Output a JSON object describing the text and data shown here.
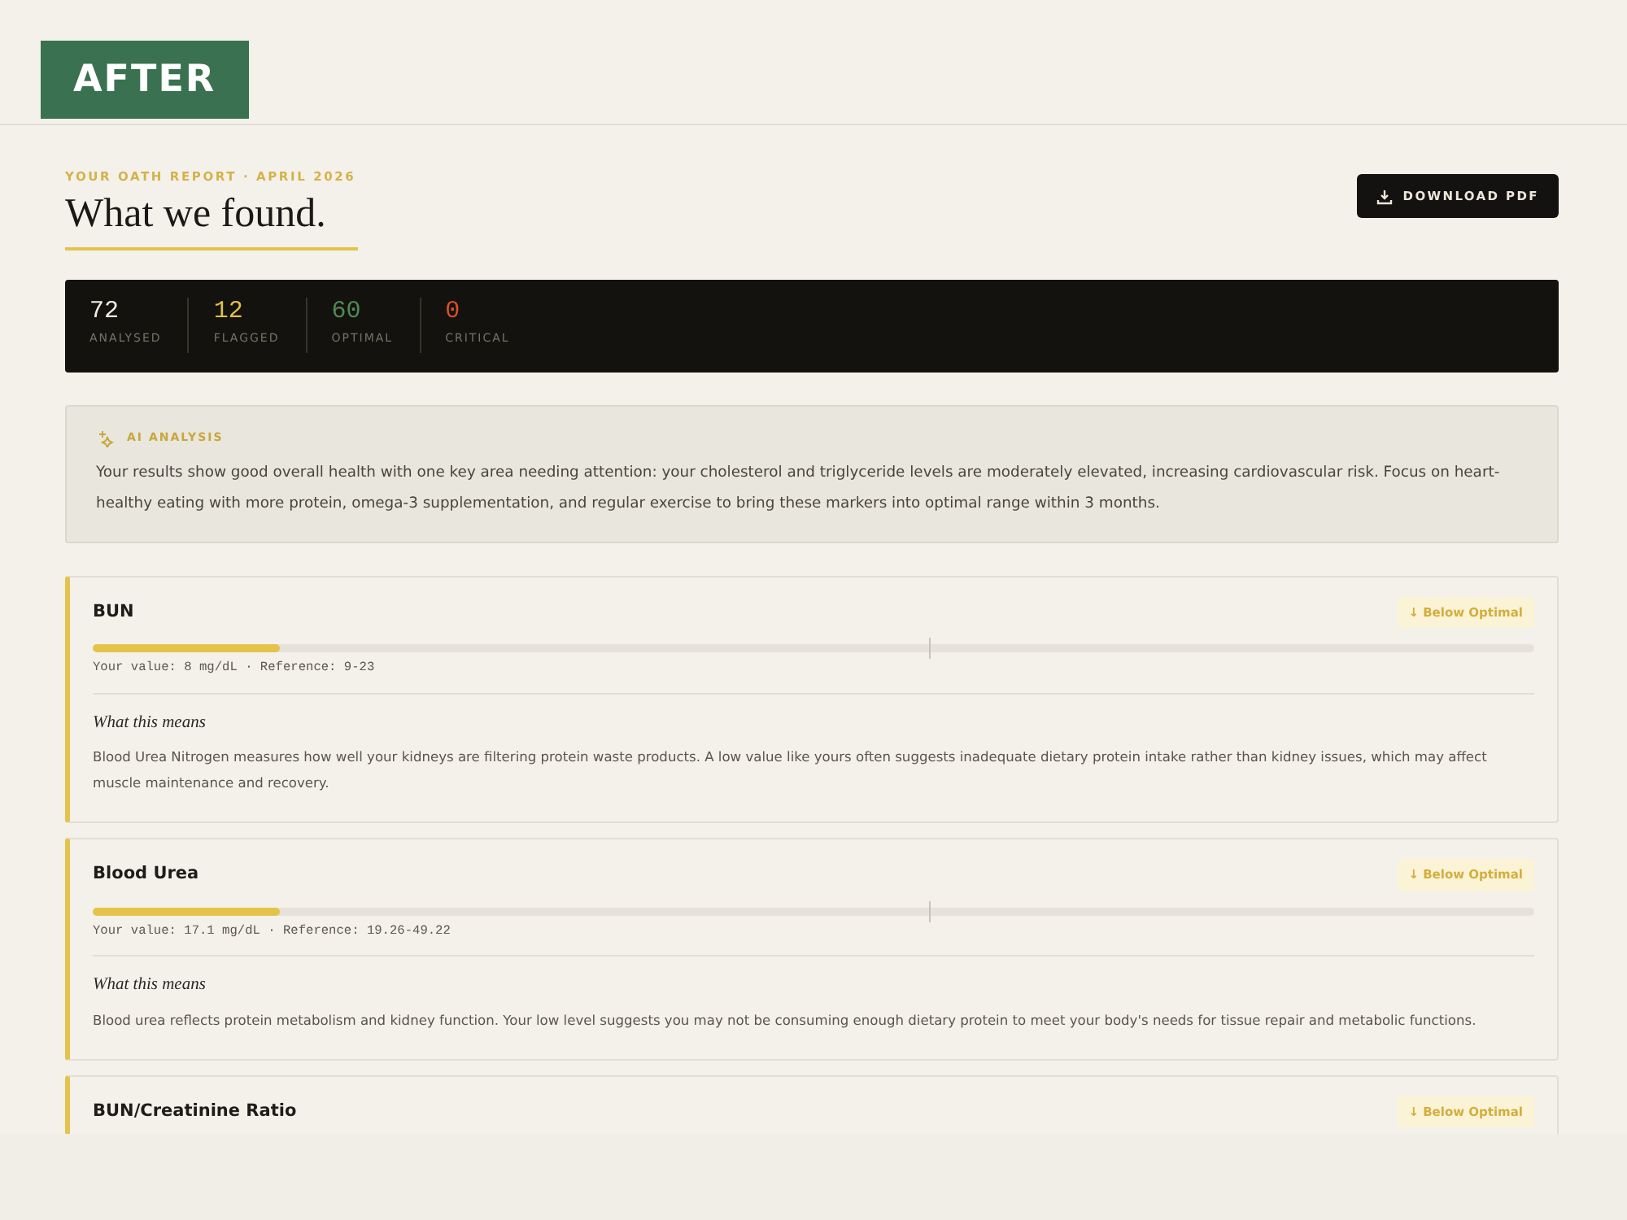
{
  "overlay_label": "AFTER",
  "header": {
    "eyebrow": "YOUR OATH REPORT · APRIL 2026",
    "title": "What we found.",
    "download_button": "DOWNLOAD PDF"
  },
  "stats": [
    {
      "value": "72",
      "label": "ANALYSED",
      "color": "#f2ede4"
    },
    {
      "value": "12",
      "label": "FLAGGED",
      "color": "#e2c04a"
    },
    {
      "value": "60",
      "label": "OPTIMAL",
      "color": "#4f8a57"
    },
    {
      "value": "0",
      "label": "CRITICAL",
      "color": "#d9502a"
    }
  ],
  "ai_analysis": {
    "label": "AI ANALYSIS",
    "text": "Your results show good overall health with one key area needing attention: your cholesterol and triglyceride levels are moderately elevated, increasing cardiovascular risk. Focus on heart-healthy eating with more protein, omega-3 supplementation, and regular exercise to bring these markers into optimal range within 3 months."
  },
  "markers": [
    {
      "name": "BUN",
      "kind": "below",
      "badge": "↓ Below Optimal",
      "level": 0.13,
      "reading": "Your value: 8 mg/dL · Reference: 9-23",
      "explain_title": "What this means",
      "explain": "Blood Urea Nitrogen measures how well your kidneys are filtering protein waste products. A low value like yours often suggests inadequate dietary protein intake rather than kidney issues, which may affect muscle maintenance and recovery."
    },
    {
      "name": "Blood Urea",
      "kind": "below",
      "badge": "↓ Below Optimal",
      "level": 0.13,
      "reading": "Your value: 17.1 mg/dL · Reference: 19.26-49.22",
      "explain_title": "What this means",
      "explain": "Blood urea reflects protein metabolism and kidney function. Your low level suggests you may not be consuming enough dietary protein to meet your body's needs for tissue repair and metabolic functions."
    },
    {
      "name": "BUN/Creatinine Ratio",
      "kind": "below",
      "badge": "↓ Below Optimal"
    }
  ]
}
